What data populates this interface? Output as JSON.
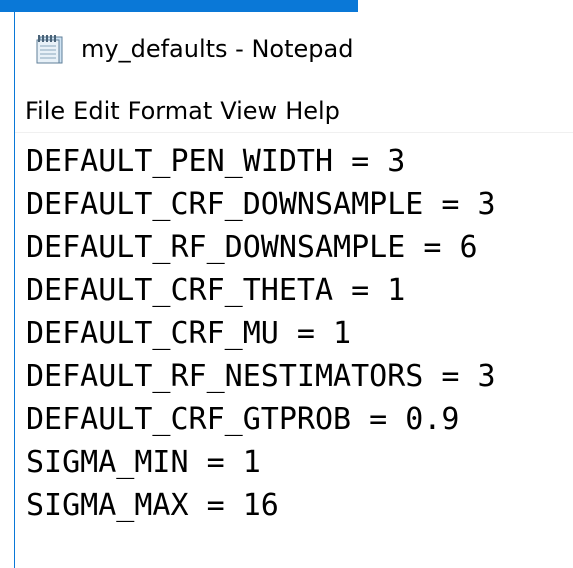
{
  "window": {
    "title": "my_defaults - Notepad",
    "icon": "notepad-icon"
  },
  "menu": {
    "items": [
      "File",
      "Edit",
      "Format",
      "View",
      "Help"
    ]
  },
  "editor": {
    "lines": [
      "DEFAULT_PEN_WIDTH = 3",
      "DEFAULT_CRF_DOWNSAMPLE = 3",
      "DEFAULT_RF_DOWNSAMPLE = 6",
      "DEFAULT_CRF_THETA = 1",
      "DEFAULT_CRF_MU = 1",
      "DEFAULT_RF_NESTIMATORS = 3",
      "DEFAULT_CRF_GTPROB = 0.9",
      "SIGMA_MIN = 1",
      "SIGMA_MAX = 16"
    ]
  },
  "colors": {
    "accent": "#0a78d7",
    "text": "#000000",
    "background": "#ffffff"
  }
}
